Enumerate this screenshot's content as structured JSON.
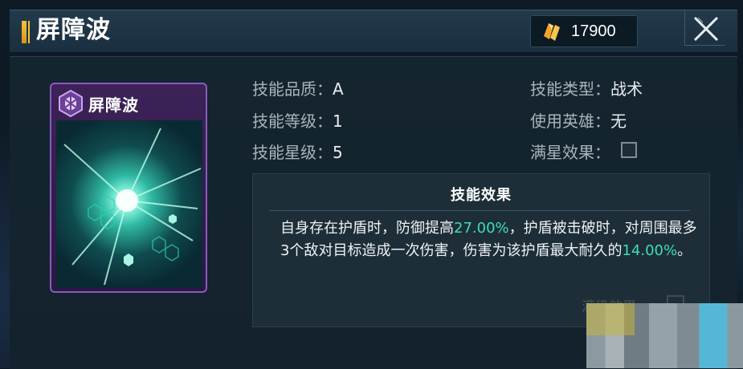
{
  "header": {
    "title": "屏障波",
    "currency_value": "17900",
    "accent_color": "#f4c23c"
  },
  "card": {
    "name": "屏障波",
    "rarity_color": "#8a5ac2",
    "badge_icon": "hexagon-emblem-icon"
  },
  "stats": {
    "quality_label": "技能品质：",
    "quality_value": "A",
    "level_label": "技能等级：",
    "level_value": "1",
    "star_label": "技能星级：",
    "star_value": "5",
    "type_label": "技能类型：",
    "type_value": "战术",
    "hero_label": "使用英雄：",
    "hero_value": "无",
    "fullstar_label": "满星效果："
  },
  "effect": {
    "title": "技能效果",
    "text_1": "自身存在护盾时，防御提高",
    "value_1": "27.00%",
    "text_2": "，护盾被击破时，对周围最多3个敌对目标造成一次伤害，伤害为该护盾最大耐久的",
    "value_2": "14.00%",
    "text_3": "。",
    "highlight_color": "#3fdcb8"
  },
  "faded_row": {
    "label": "满级效果"
  }
}
